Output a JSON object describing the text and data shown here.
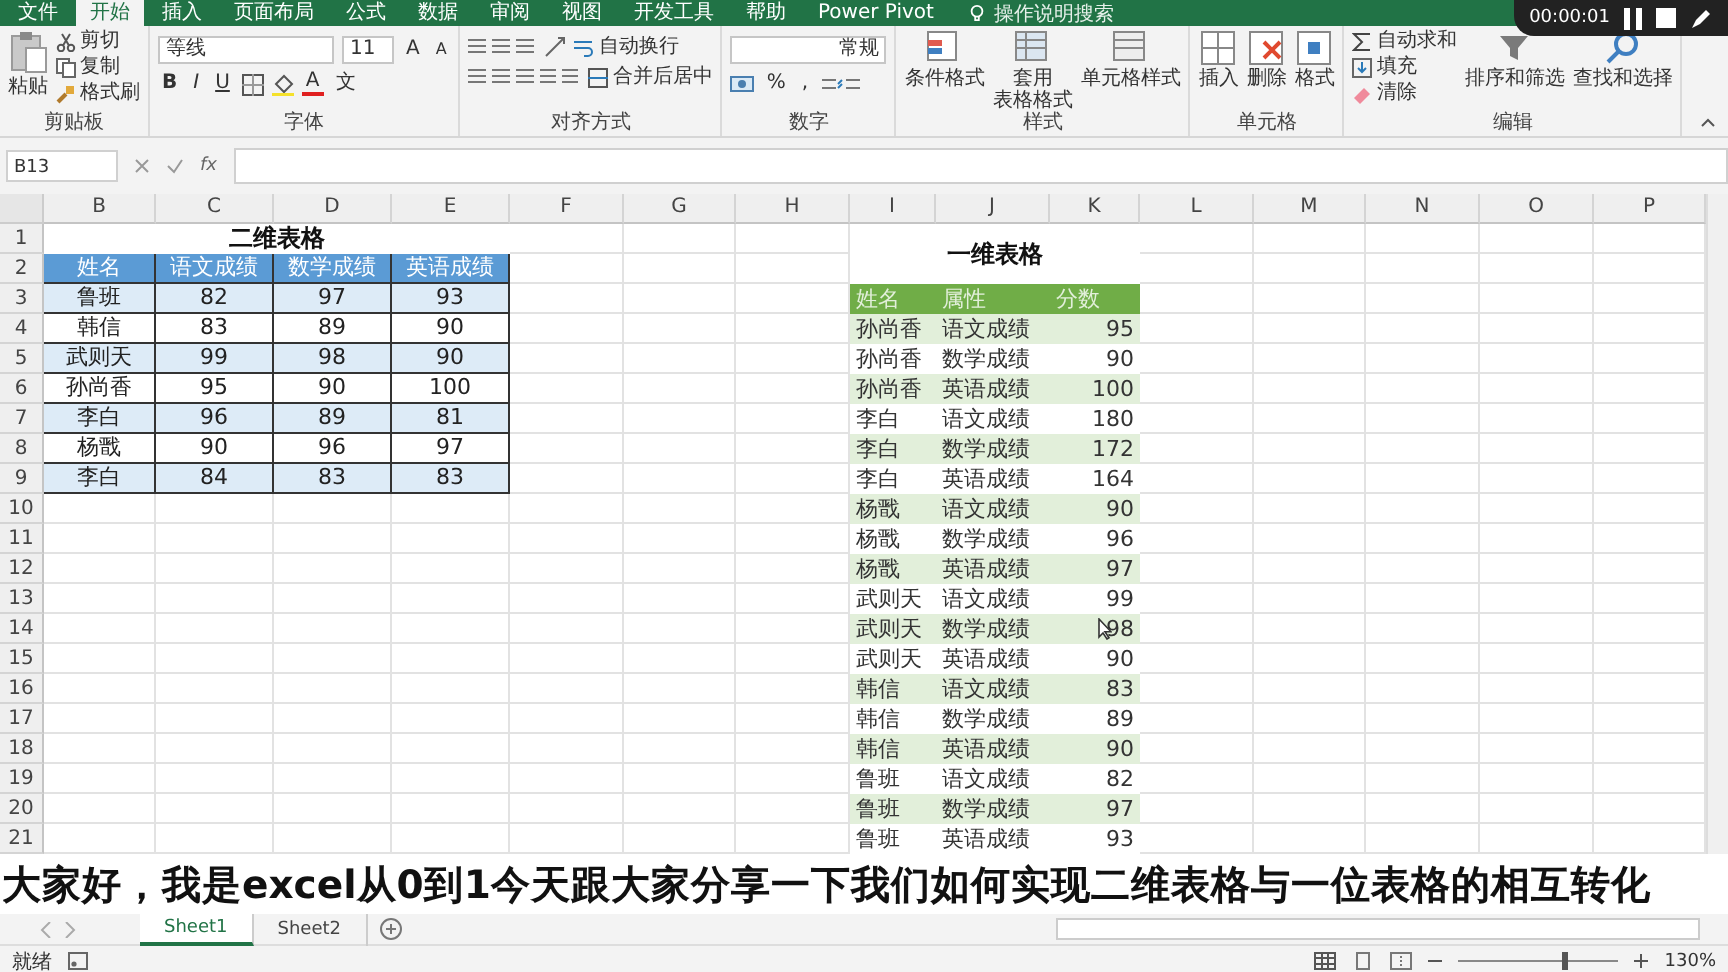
{
  "menu_tabs": [
    {
      "label": "文件",
      "selected": false
    },
    {
      "label": "开始",
      "selected": true
    },
    {
      "label": "插入",
      "selected": false
    },
    {
      "label": "页面布局",
      "selected": false
    },
    {
      "label": "公式",
      "selected": false
    },
    {
      "label": "数据",
      "selected": false
    },
    {
      "label": "审阅",
      "selected": false
    },
    {
      "label": "视图",
      "selected": false
    },
    {
      "label": "开发工具",
      "selected": false
    },
    {
      "label": "帮助",
      "selected": false
    },
    {
      "label": "Power Pivot",
      "selected": false
    }
  ],
  "search": {
    "placeholder": "操作说明搜索"
  },
  "recorder": {
    "time": "00:00:01"
  },
  "ribbon": {
    "clipboard": {
      "label": "剪贴板",
      "paste": "粘贴",
      "cut": "剪切",
      "copy": "复制",
      "painter": "格式刷"
    },
    "font": {
      "label": "字体",
      "family": "等线",
      "size": "11",
      "grow": "A",
      "shrink": "A",
      "bold": "B",
      "italic": "I",
      "underline": "U",
      "font_color": "A",
      "phonetic": "文"
    },
    "alignment": {
      "label": "对齐方式",
      "wrap": "自动换行",
      "merge": "合并后居中"
    },
    "number": {
      "label": "数字",
      "format": "常规",
      "percent": "%",
      "comma": ","
    },
    "styles": {
      "label": "样式",
      "conditional": "条件格式",
      "table_format_top": "套用",
      "table_format_bottom": "表格格式",
      "cell_styles": "单元格样式"
    },
    "cells": {
      "label": "单元格",
      "insert": "插入",
      "delete": "删除",
      "format": "格式"
    },
    "editing": {
      "label": "编辑",
      "autosum": "自动求和",
      "fill": "填充",
      "clear": "清除",
      "sort": "排序和筛选",
      "find": "查找和选择"
    }
  },
  "formula_bar": {
    "name_box": "B13",
    "fx": "fx"
  },
  "sheet": {
    "columns": [
      "B",
      "C",
      "D",
      "E",
      "F",
      "G",
      "H",
      "I",
      "J",
      "K",
      "L",
      "M",
      "N",
      "O",
      "P"
    ],
    "rows": [
      "1",
      "2",
      "3",
      "4",
      "5",
      "6",
      "7",
      "8",
      "9",
      "10",
      "11",
      "12",
      "13",
      "14",
      "15",
      "16",
      "17",
      "18",
      "19",
      "20",
      "21"
    ],
    "two_d_table": {
      "title": "二维表格",
      "headers": [
        "姓名",
        "语文成绩",
        "数学成绩",
        "英语成绩"
      ],
      "rows": [
        [
          "鲁班",
          "82",
          "97",
          "93"
        ],
        [
          "韩信",
          "83",
          "89",
          "90"
        ],
        [
          "武则天",
          "99",
          "98",
          "90"
        ],
        [
          "孙尚香",
          "95",
          "90",
          "100"
        ],
        [
          "李白",
          "96",
          "89",
          "81"
        ],
        [
          "杨戬",
          "90",
          "96",
          "97"
        ],
        [
          "李白",
          "84",
          "83",
          "83"
        ]
      ]
    },
    "one_d_table": {
      "title": "一维表格",
      "headers": [
        "姓名",
        "属性",
        "分数"
      ],
      "rows": [
        [
          "孙尚香",
          "语文成绩",
          "95"
        ],
        [
          "孙尚香",
          "数学成绩",
          "90"
        ],
        [
          "孙尚香",
          "英语成绩",
          "100"
        ],
        [
          "李白",
          "语文成绩",
          "180"
        ],
        [
          "李白",
          "数学成绩",
          "172"
        ],
        [
          "李白",
          "英语成绩",
          "164"
        ],
        [
          "杨戬",
          "语文成绩",
          "90"
        ],
        [
          "杨戬",
          "数学成绩",
          "96"
        ],
        [
          "杨戬",
          "英语成绩",
          "97"
        ],
        [
          "武则天",
          "语文成绩",
          "99"
        ],
        [
          "武则天",
          "数学成绩",
          "98"
        ],
        [
          "武则天",
          "英语成绩",
          "90"
        ],
        [
          "韩信",
          "语文成绩",
          "83"
        ],
        [
          "韩信",
          "数学成绩",
          "89"
        ],
        [
          "韩信",
          "英语成绩",
          "90"
        ],
        [
          "鲁班",
          "语文成绩",
          "82"
        ],
        [
          "鲁班",
          "数学成绩",
          "97"
        ],
        [
          "鲁班",
          "英语成绩",
          "93"
        ]
      ]
    }
  },
  "subtitle": "大家好，我是excel从0到1今天跟大家分享一下我们如何实现二维表格与一位表格的相互转化",
  "sheet_tabs": [
    {
      "label": "Sheet1",
      "selected": true
    },
    {
      "label": "Sheet2",
      "selected": false
    }
  ],
  "status_bar": {
    "status": "就绪",
    "zoom": {
      "level": 0.65,
      "reading": "130%"
    }
  }
}
